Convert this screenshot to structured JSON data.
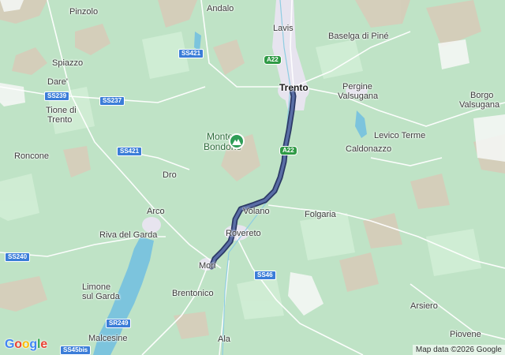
{
  "map": {
    "colors": {
      "terrain": "#bfe3c6",
      "mountain": "#d9c9b6",
      "urban": "#e6e3ee",
      "water": "#7cc4dd",
      "road": "#ffffff",
      "route": "#4a5a8a",
      "route_outline": "#2c3a66"
    },
    "labels": {
      "pinzolo": "Pinzolo",
      "andalo": "Andalo",
      "lavis": "Lavis",
      "baselga": "Baselga di Piné",
      "spiazzo": "Spiazzo",
      "dare": "Dare'",
      "tione_1": "Tione di",
      "tione_2": "Trento",
      "trento": "Trento",
      "pergine_1": "Pergine",
      "pergine_2": "Valsugana",
      "borgo_1": "Borgo",
      "borgo_2": "Valsugana",
      "levico": "Levico Terme",
      "caldonazzo": "Caldonazzo",
      "monte_1": "Monte",
      "monte_2": "Bondone",
      "roncone": "Roncone",
      "dro": "Dro",
      "arco": "Arco",
      "volano": "Volano",
      "folgaria": "Folgaria",
      "riva": "Riva del Garda",
      "rovereto": "Rovereto",
      "mori": "Mori",
      "limone_1": "Limone",
      "limone_2": "sul Garda",
      "brentonico": "Brentonico",
      "arsiero": "Arsiero",
      "piovene": "Piovene",
      "malcesine": "Malcesine",
      "ala": "Ala"
    },
    "shields": {
      "ss421_top": "SS421",
      "a22_top": "A22",
      "ss239": "SS239",
      "ss237": "SS237",
      "ss421_mid": "SS421",
      "a22_mid": "A22",
      "ss240": "SS240",
      "ss46": "SS46",
      "sr249": "SR249",
      "ss45bis": "SS45bis"
    },
    "poi_icon": "mountain-peak-icon",
    "logo_letters": [
      "G",
      "o",
      "o",
      "g",
      "l",
      "e"
    ],
    "logo_colors": [
      "#4285F4",
      "#EA4335",
      "#FBBC05",
      "#4285F4",
      "#34A853",
      "#EA4335"
    ],
    "attribution": "Map data ©2026 Google"
  }
}
